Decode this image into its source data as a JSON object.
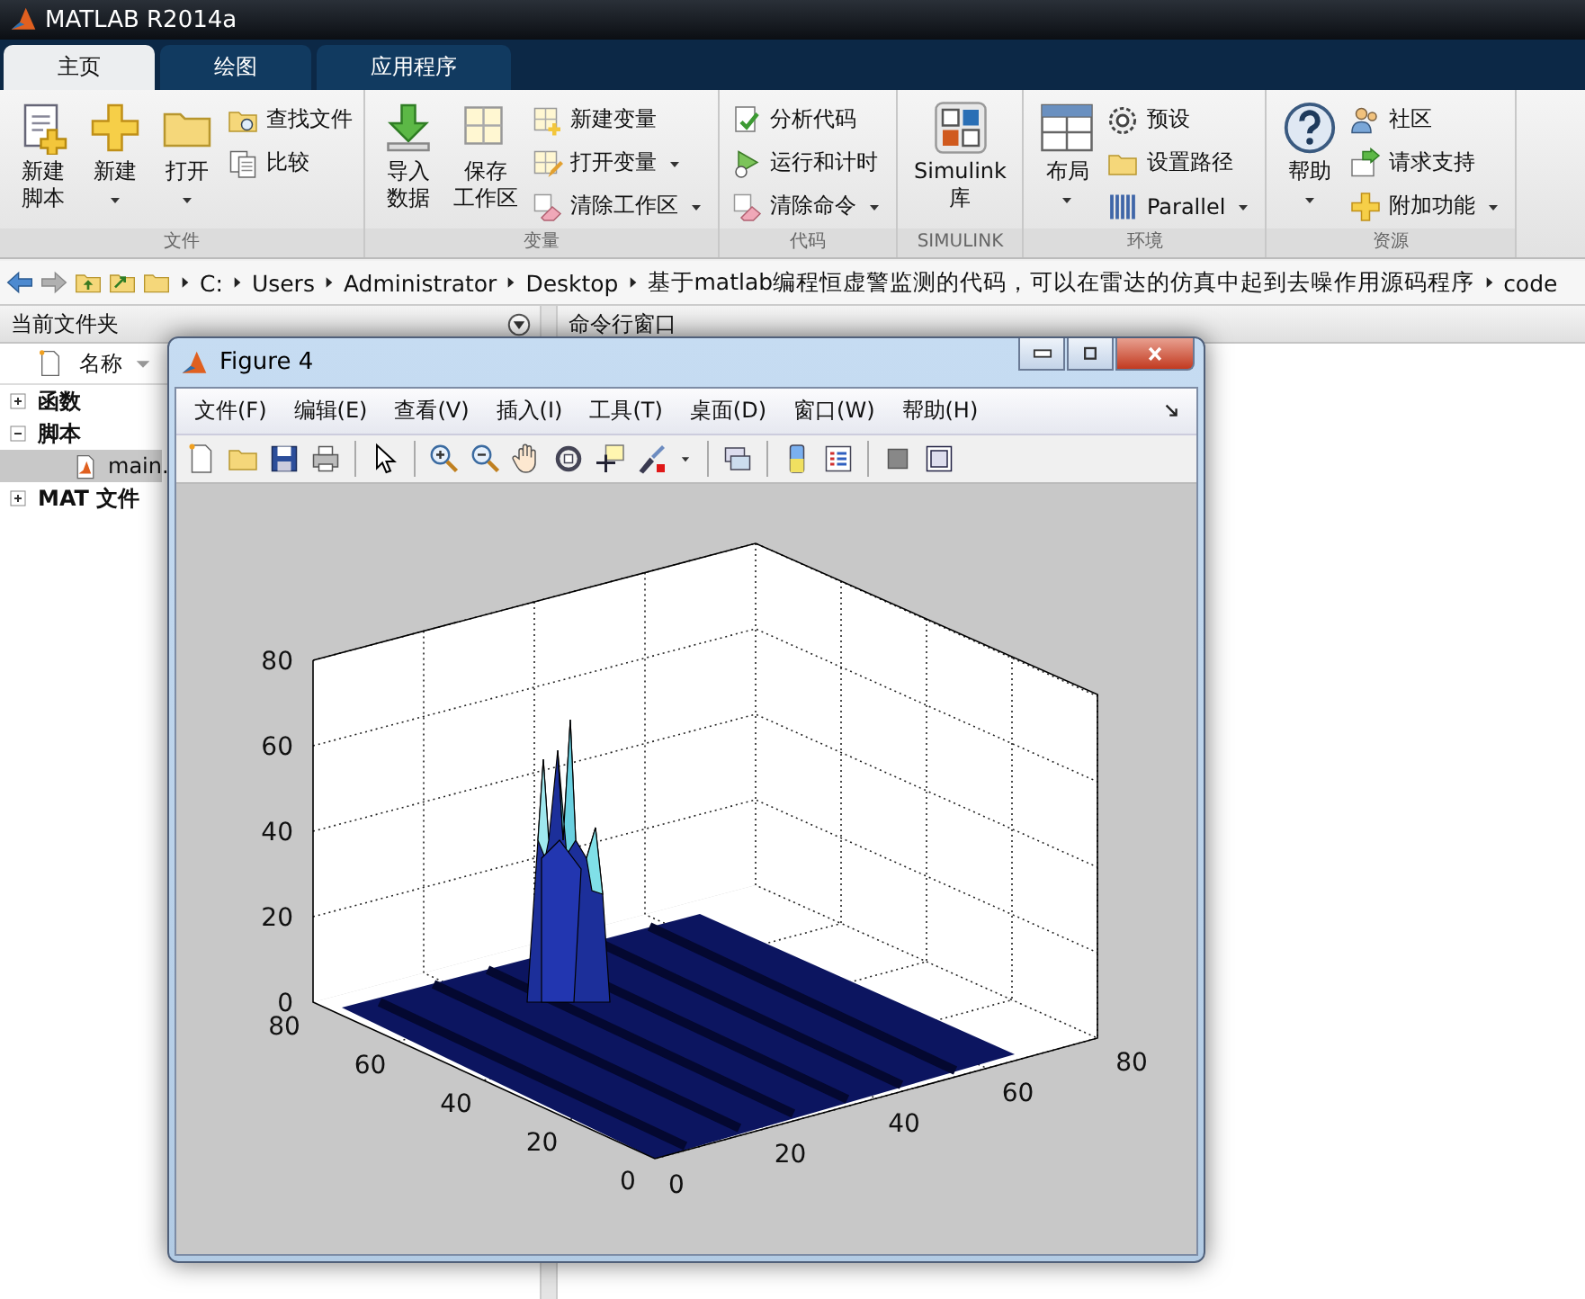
{
  "app": {
    "title": "MATLAB R2014a"
  },
  "tabs": [
    {
      "label": "主页",
      "selected": true
    },
    {
      "label": "绘图",
      "selected": false
    },
    {
      "label": "应用程序",
      "selected": false
    }
  ],
  "ribbon": [
    {
      "label": "文件",
      "items": [
        {
          "kind": "big",
          "lines": [
            "新建",
            "脚本"
          ],
          "dropdown": false
        },
        {
          "kind": "big",
          "lines": [
            "新建"
          ],
          "dropdown": true
        },
        {
          "kind": "big",
          "lines": [
            "打开"
          ],
          "dropdown": true
        },
        {
          "kind": "small",
          "label": "查找文件",
          "dropdown": false
        },
        {
          "kind": "small",
          "label": "比较",
          "dropdown": false
        }
      ]
    },
    {
      "label": "变量",
      "items": [
        {
          "kind": "big",
          "lines": [
            "导入",
            "数据"
          ],
          "dropdown": false
        },
        {
          "kind": "big",
          "lines": [
            "保存",
            "工作区"
          ],
          "dropdown": false
        },
        {
          "kind": "small",
          "label": "新建变量",
          "dropdown": false
        },
        {
          "kind": "small",
          "label": "打开变量",
          "dropdown": true
        },
        {
          "kind": "small",
          "label": "清除工作区",
          "dropdown": true
        }
      ]
    },
    {
      "label": "代码",
      "items": [
        {
          "kind": "small",
          "label": "分析代码",
          "dropdown": false
        },
        {
          "kind": "small",
          "label": "运行和计时",
          "dropdown": false
        },
        {
          "kind": "small",
          "label": "清除命令",
          "dropdown": true
        }
      ]
    },
    {
      "label": "SIMULINK",
      "items": [
        {
          "kind": "big",
          "lines": [
            "Simulink",
            "库"
          ],
          "dropdown": false
        }
      ]
    },
    {
      "label": "环境",
      "items": [
        {
          "kind": "big",
          "lines": [
            "布局"
          ],
          "dropdown": true
        },
        {
          "kind": "small",
          "label": "预设",
          "dropdown": false
        },
        {
          "kind": "small",
          "label": "设置路径",
          "dropdown": false
        },
        {
          "kind": "small",
          "label": "Parallel",
          "dropdown": true
        }
      ]
    },
    {
      "label": "资源",
      "items": [
        {
          "kind": "big",
          "lines": [
            "帮助"
          ],
          "dropdown": true
        },
        {
          "kind": "small",
          "label": "社区",
          "dropdown": false
        },
        {
          "kind": "small",
          "label": "请求支持",
          "dropdown": false
        },
        {
          "kind": "small",
          "label": "附加功能",
          "dropdown": true
        }
      ]
    }
  ],
  "path": {
    "crumbs": [
      "C:",
      "Users",
      "Administrator",
      "Desktop",
      "基于matlab编程恒虚警监测的代码，可以在雷达的仿真中起到去噪作用源码程序",
      "code"
    ]
  },
  "file_panel": {
    "title": "当前文件夹",
    "column": "名称",
    "tree": [
      {
        "label": "函数",
        "expanded": false
      },
      {
        "label": "脚本",
        "expanded": true,
        "children": [
          {
            "label": "main.",
            "selected": true
          }
        ]
      },
      {
        "label": "MAT 文件",
        "expanded": false
      }
    ]
  },
  "command_window": {
    "title": "命令行窗口"
  },
  "figure": {
    "title": "Figure 4",
    "menu": [
      "文件(F)",
      "编辑(E)",
      "查看(V)",
      "插入(I)",
      "工具(T)",
      "桌面(D)",
      "窗口(W)",
      "帮助(H)"
    ],
    "axes": {
      "z_ticks": [
        "80",
        "60",
        "40",
        "20",
        "0"
      ],
      "y_ticks": [
        "80",
        "60",
        "40",
        "20",
        "0"
      ],
      "x_ticks": [
        "0",
        "20",
        "40",
        "60",
        "80"
      ]
    }
  }
}
